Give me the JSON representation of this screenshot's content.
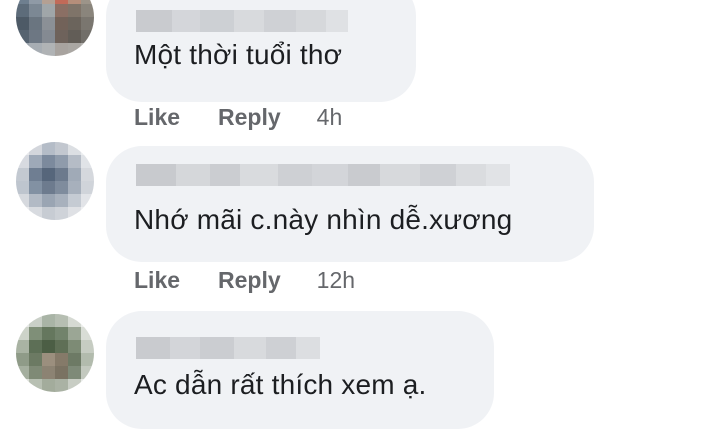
{
  "comments": [
    {
      "text": "Một thời tuổi thơ",
      "like_label": "Like",
      "reply_label": "Reply",
      "time": "4h"
    },
    {
      "text": "Nhớ mãi c.này nhìn dễ.xương",
      "like_label": "Like",
      "reply_label": "Reply",
      "time": "12h"
    },
    {
      "text": "Ac dẫn rất thích xem ạ."
    }
  ],
  "colors": {
    "bubble": "#f0f2f5",
    "text": "#1c1e21",
    "meta": "#65676b"
  }
}
